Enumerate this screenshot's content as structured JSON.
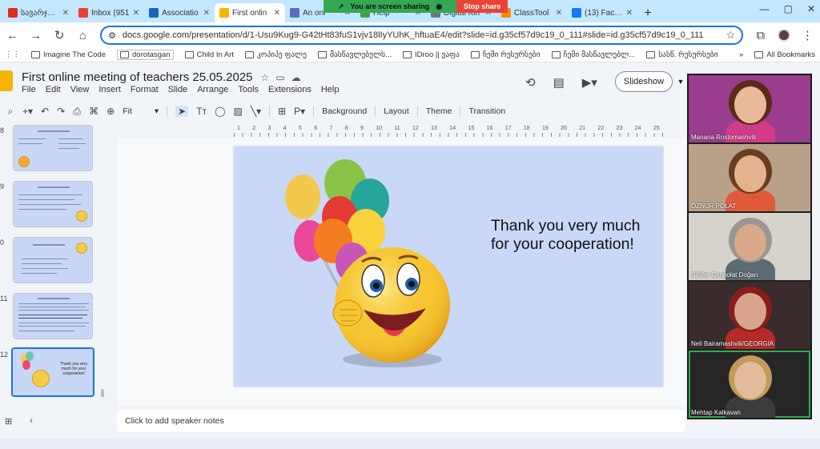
{
  "browser": {
    "tabs": [
      {
        "title": "სავარჯიშო",
        "favicon_color": "#d93025",
        "active": false
      },
      {
        "title": "Inbox (951",
        "favicon_color": "#ea4335",
        "active": false
      },
      {
        "title": "Associatio",
        "favicon_color": "#1565c0",
        "active": false
      },
      {
        "title": "First onlin",
        "favicon_color": "#f4b400",
        "active": true
      },
      {
        "title": "An onl",
        "favicon_color": "#5c6bc0",
        "active": false
      },
      {
        "title": "Help",
        "favicon_color": "#43a047",
        "active": false
      },
      {
        "title": "Digital Kin",
        "favicon_color": "#757575",
        "active": false
      },
      {
        "title": "ClassTool",
        "favicon_color": "#fb8c00",
        "active": false
      },
      {
        "title": "(13) Faceb",
        "favicon_color": "#1877f2",
        "active": false
      }
    ],
    "new_tab_symbol": "+",
    "window_controls": [
      "—",
      "▢",
      "✕"
    ],
    "screen_share": {
      "message": "You are screen sharing",
      "stop_label": "Stop share"
    },
    "url": "docs.google.com/presentation/d/1-Usu9Kug9-G42tHt83fuS1vjv18lIyYUhK_hftuaE4/edit?slide=id.g35cf57d9c19_0_111#slide=id.g35cf57d9c19_0_111",
    "bookmarks": [
      {
        "label": "Imagine The Code",
        "boxed": false
      },
      {
        "label": "dorotasgan",
        "boxed": true
      },
      {
        "label": "Child In Art",
        "boxed": false
      },
      {
        "label": "კოპიპე ფალე",
        "boxed": false
      },
      {
        "label": "მასწავლებელს...",
        "boxed": false
      },
      {
        "label": "IDroo || ვაფა",
        "boxed": false
      },
      {
        "label": "ჩემი რესურსები",
        "boxed": false
      },
      {
        "label": "ჩემი მასწავლებლ...",
        "boxed": false
      },
      {
        "label": "სასწ. რესურსები",
        "boxed": false
      }
    ],
    "bookmarks_more": "»",
    "all_bookmarks": "All Bookmarks"
  },
  "slides": {
    "doc_title": "First online meeting of teachers 25.05.2025",
    "menu": [
      "File",
      "Edit",
      "View",
      "Insert",
      "Format",
      "Slide",
      "Arrange",
      "Tools",
      "Extensions",
      "Help"
    ],
    "slideshow_label": "Slideshow",
    "toolbar": {
      "zoom": "Fit",
      "background": "Background",
      "layout": "Layout",
      "theme": "Theme",
      "transition": "Transition"
    },
    "ruler_numbers": [
      "1",
      "2",
      "3",
      "4",
      "5",
      "6",
      "7",
      "8",
      "9",
      "10",
      "11",
      "12",
      "13",
      "14",
      "15",
      "16",
      "17",
      "18",
      "19",
      "20",
      "21",
      "22",
      "23",
      "24",
      "25"
    ],
    "thumbnails": [
      {
        "number": "8",
        "selected": false
      },
      {
        "number": "9",
        "selected": false
      },
      {
        "number": "0",
        "selected": false
      },
      {
        "number": "11",
        "selected": false
      },
      {
        "number": "12",
        "selected": true
      }
    ],
    "current_slide": {
      "text": "Thank you very much for your cooperation!"
    },
    "speaker_notes_placeholder": "Click to add speaker notes"
  },
  "meeting": {
    "participants": [
      {
        "name": "Manana Rostomashvili",
        "bg": "#9b3d8f",
        "skin": "#e9b99a",
        "hair": "#5a2a1a",
        "shirt": "#d33b8a"
      },
      {
        "name": "ÖZNUR POLAT",
        "bg": "#b9a089",
        "skin": "#e3b38f",
        "hair": "#6b3d1f",
        "shirt": "#e05a3a"
      },
      {
        "name": "Nilüfer Canpolat Doğan",
        "bg": "#d6d2cc",
        "skin": "#d9a98a",
        "hair": "#9a9690",
        "shirt": "#5c6b73"
      },
      {
        "name": "Neli Bairamashvili/GEORGIA",
        "bg": "#3a2c2c",
        "skin": "#d8a58c",
        "hair": "#8a1c1c",
        "shirt": "#b72a2a"
      },
      {
        "name": "Mehtap Kalkavan",
        "bg": "#262626",
        "skin": "#e2bb9a",
        "hair": "#c49a5a",
        "shirt": "#3b3b3b"
      }
    ]
  }
}
